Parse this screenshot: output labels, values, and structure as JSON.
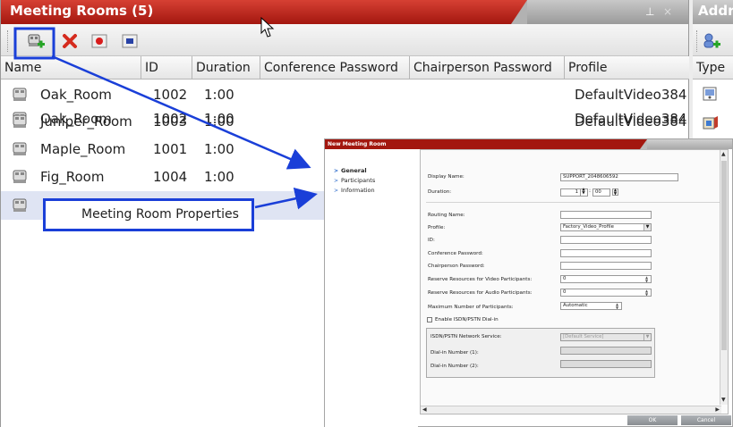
{
  "meeting_rooms": {
    "title": "Meeting Rooms (5)",
    "controls": {
      "pin": "⊥",
      "close": "×"
    },
    "columns": [
      "Name",
      "ID",
      "Duration",
      "Conference Password",
      "Chairperson Password",
      "Profile"
    ],
    "rows": [
      {
        "name": "Oak_Room",
        "id": "1002",
        "duration": "1:00",
        "profile": "DefaultVideo384"
      },
      {
        "name": "Juniper_Room",
        "id": "1003",
        "duration": "1:00",
        "profile": "DefaultVideo384"
      },
      {
        "name": "Maple_Room",
        "id": "1001",
        "duration": "1:00",
        "profile": ""
      },
      {
        "name": "Fig_Room",
        "id": "1004",
        "duration": "1:00",
        "profile": ""
      }
    ]
  },
  "address_pane": {
    "title": "Addr",
    "column": "Type"
  },
  "context_menu": {
    "label": "Meeting Room Properties"
  },
  "dialog": {
    "title": "New Meeting Room",
    "nav": [
      "General",
      "Participants",
      "Information"
    ],
    "fields": {
      "display_name_label": "Display Name:",
      "display_name_value": "SUPPORT_2048606592",
      "duration_label": "Duration:",
      "duration_hours": "1",
      "duration_minutes": "00",
      "routing_name_label": "Routing Name:",
      "profile_label": "Profile:",
      "profile_value": "Factory_Video_Profile",
      "id_label": "ID:",
      "conf_pwd_label": "Conference Password:",
      "chair_pwd_label": "Chairperson Password:",
      "reserve_video_label": "Reserve Resources for Video Participants:",
      "reserve_video_value": "0",
      "reserve_audio_label": "Reserve Resources for Audio Participants:",
      "reserve_audio_value": "0",
      "max_participants_label": "Maximum Number of Participants:",
      "max_participants_value": "Automatic",
      "enable_isdn_label": "Enable ISDN/PSTN Dial-in",
      "isdn_service_label": "ISDN/PSTN Network Service:",
      "isdn_service_value": "[Default Service]",
      "dialin1_label": "Dial-in Number (1):",
      "dialin2_label": "Dial-in Number (2):"
    },
    "ok": "OK",
    "cancel": "Cancel"
  },
  "colors": {
    "title_red": "#a3170f",
    "annotation_blue": "#1a3fd8",
    "selected_row": "#dfe4f3"
  },
  "icons": [
    "add-meeting-room-icon",
    "delete-icon",
    "record-icon",
    "stop-icon",
    "meeting-room-icon",
    "mouse-cursor-icon"
  ]
}
